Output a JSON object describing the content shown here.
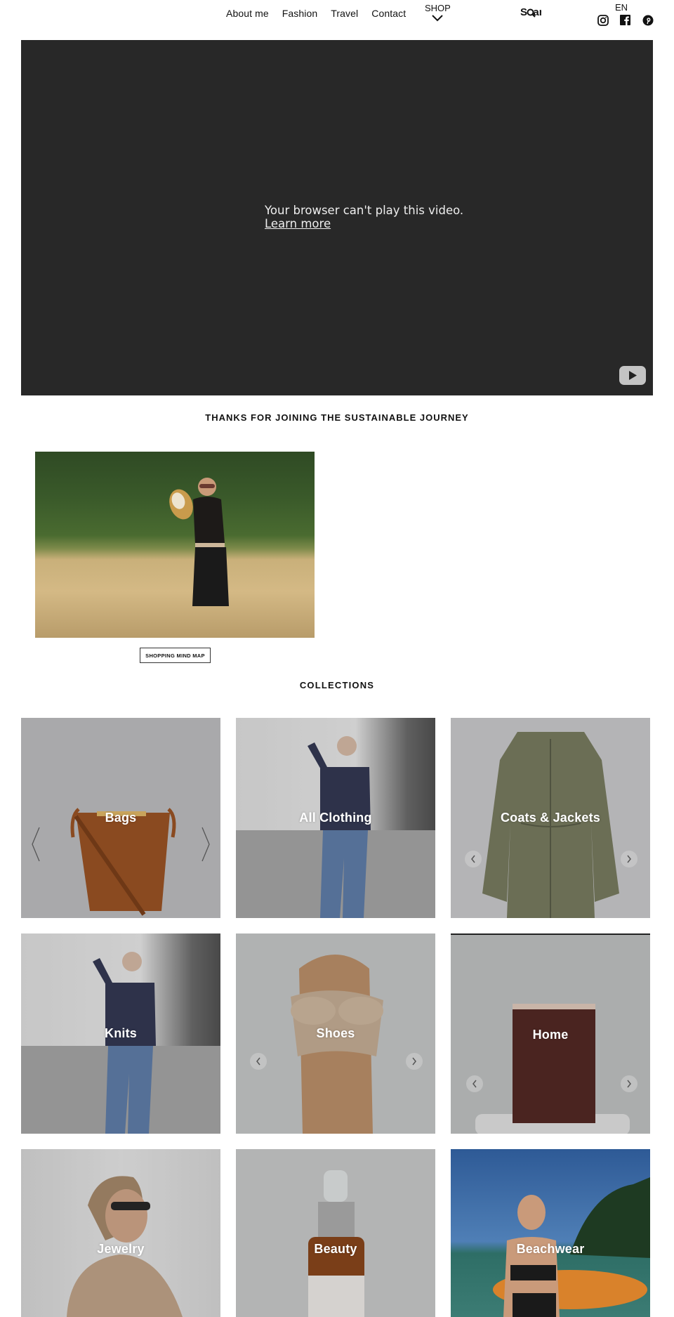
{
  "header": {
    "nav": [
      {
        "label": "About me"
      },
      {
        "label": "Fashion"
      },
      {
        "label": "Travel"
      },
      {
        "label": "Contact"
      }
    ],
    "shop_label": "SHOP",
    "shop_icon": "chevron-down-icon",
    "search_label": "Search",
    "search_icon": "search-icon",
    "language": "EN",
    "social": [
      {
        "name": "instagram-icon"
      },
      {
        "name": "facebook-icon"
      },
      {
        "name": "pinterest-icon"
      }
    ]
  },
  "video": {
    "message": "Your browser can't play this video.",
    "link": "Learn more",
    "logo_icon": "youtube-play-icon"
  },
  "thanks": {
    "title": "THANKS FOR JOINING THE SUSTAINABLE JOURNEY",
    "button": "SHOPPING MIND MAP"
  },
  "collections": {
    "title": "COLLECTIONS",
    "items": [
      {
        "label": "Bags",
        "arrows": "thin",
        "colors": {
          "bg": "#a9a9ab",
          "accent": "#8a4a20"
        }
      },
      {
        "label": "All Clothing",
        "arrows": "none",
        "colors": {
          "bg": "#c8c8c8",
          "accent": "#1e2340"
        }
      },
      {
        "label": "Coats & Jackets",
        "arrows": "round",
        "colors": {
          "bg": "#b4b4b6",
          "accent": "#6b6e55"
        }
      },
      {
        "label": "Knits",
        "arrows": "none",
        "colors": {
          "bg": "#c8c8c8",
          "accent": "#1e2340"
        }
      },
      {
        "label": "Shoes",
        "arrows": "round",
        "colors": {
          "bg": "#b0b2b2",
          "accent": "#b09b85"
        }
      },
      {
        "label": "Home",
        "arrows": "round",
        "colors": {
          "bg": "#abadad",
          "accent": "#4a2420"
        }
      },
      {
        "label": "Jewelry",
        "arrows": "none",
        "colors": {
          "bg": "#c9c9c9",
          "accent": "#c9a88c"
        }
      },
      {
        "label": "Beauty",
        "arrows": "none",
        "colors": {
          "bg": "#b3b4b4",
          "accent": "#8a4a1e"
        }
      },
      {
        "label": "Beachwear",
        "arrows": "none",
        "colors": {
          "bg": "#3a6b9e",
          "accent": "#2e6e66"
        }
      }
    ]
  }
}
